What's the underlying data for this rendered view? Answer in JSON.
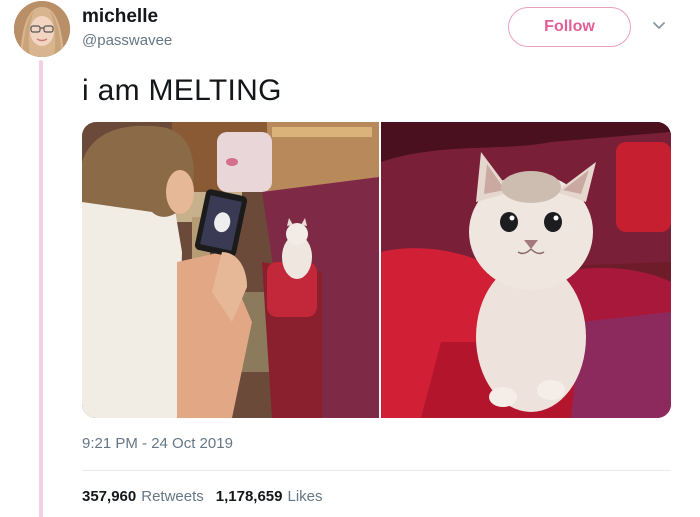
{
  "user": {
    "name": "michelle",
    "handle": "@passwavee"
  },
  "follow_label": "Follow",
  "tweet": {
    "text": "i am MELTING",
    "timestamp": "9:21 PM - 24 Oct 2019"
  },
  "stats": {
    "retweets_count": "357,960",
    "retweets_label": "Retweets",
    "likes_count": "1,178,659",
    "likes_label": "Likes"
  },
  "colors": {
    "thread_line": "#f5cfe4",
    "follow_accent": "#e35d96",
    "secondary_text": "#657786"
  },
  "icons": {
    "menu": "chevron-down-icon"
  }
}
